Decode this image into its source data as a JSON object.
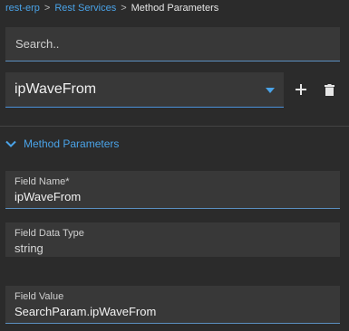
{
  "breadcrumb": {
    "items": [
      "rest-erp",
      "Rest Services"
    ],
    "current": "Method Parameters",
    "separator": ">"
  },
  "search": {
    "placeholder": "Search..",
    "value": ""
  },
  "method_select": {
    "value": "ipWaveFrom"
  },
  "section": {
    "label": "Method Parameters",
    "expanded": true
  },
  "fields": {
    "field_name": {
      "label": "Field Name",
      "required_mark": "*",
      "value": "ipWaveFrom"
    },
    "field_data_type": {
      "label": "Field Data Type",
      "value": "string"
    },
    "field_value": {
      "label": "Field Value",
      "value": "SearchParam.ipWaveFrom"
    }
  },
  "colors": {
    "background": "#2b2b2b",
    "panel": "#383838",
    "accent": "#4aa3e8",
    "text": "#e6e6e6"
  },
  "icons": [
    "caret-down-icon",
    "plus-icon",
    "trash-icon",
    "chevron-down-icon"
  ]
}
